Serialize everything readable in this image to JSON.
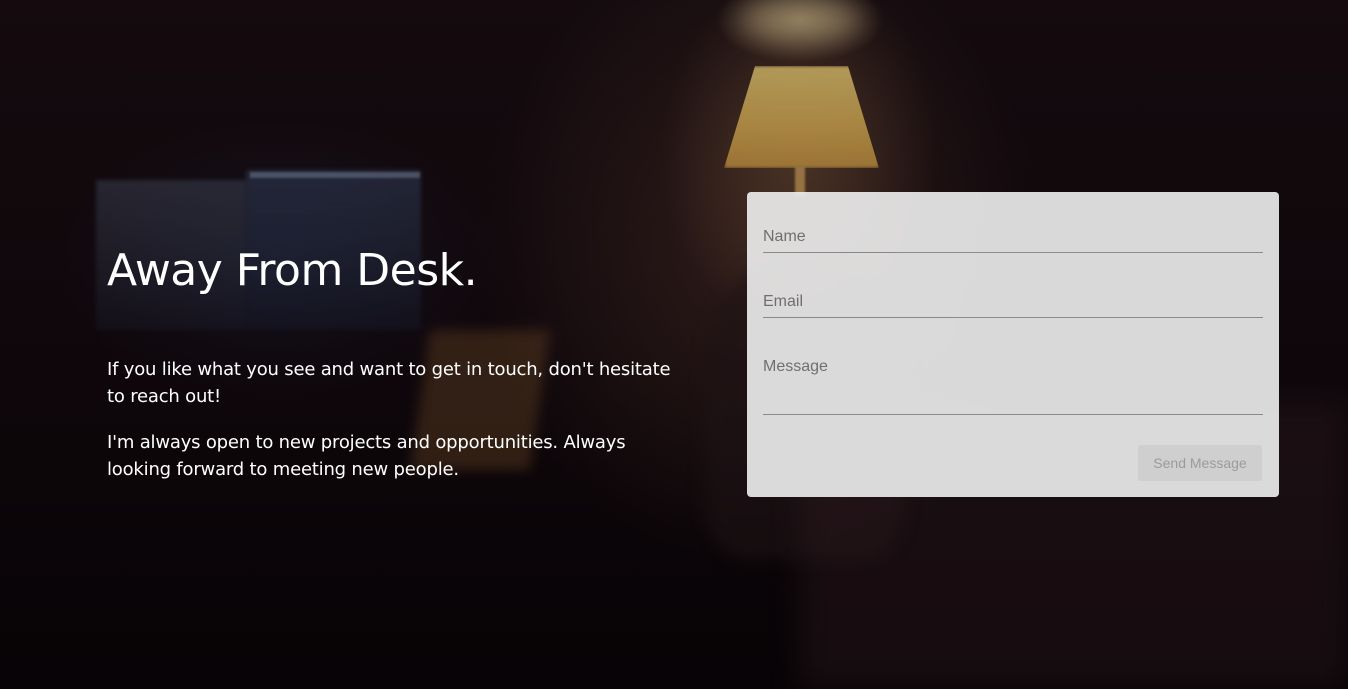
{
  "hero": {
    "title": "Away From Desk.",
    "paragraph_1": "If you like what you see and want to get in touch, don't hesitate to reach out!",
    "paragraph_2": "I'm always open to new projects and opportunities. Always looking forward to meeting new people."
  },
  "contact_form": {
    "name_placeholder": "Name",
    "email_placeholder": "Email",
    "message_placeholder": "Message",
    "send_label": "Send Message"
  },
  "colors": {
    "text": "#ffffff",
    "card_background": "#ebebeb",
    "field_underline": "#8a8a8a",
    "button_background": "#cfcfcf",
    "button_text": "#9b9b9b"
  }
}
